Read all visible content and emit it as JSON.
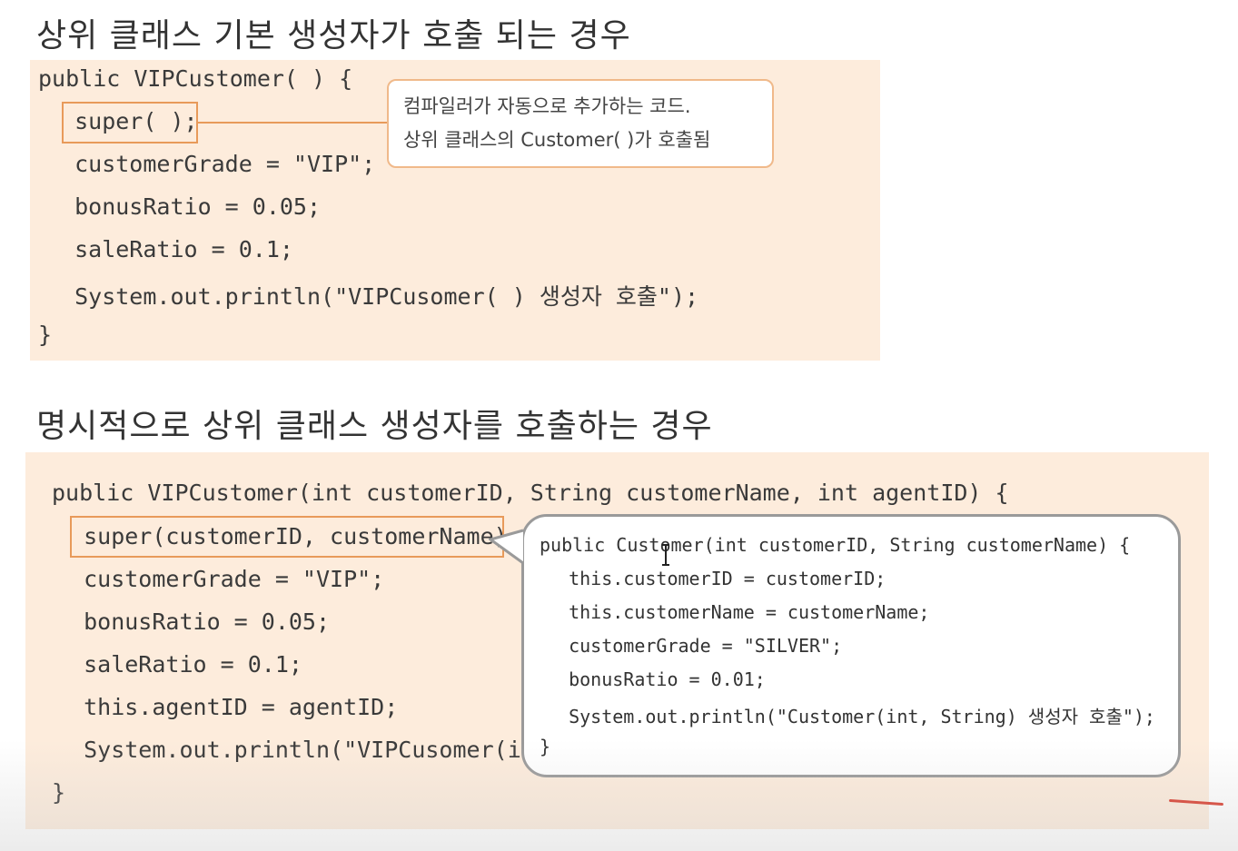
{
  "section1": {
    "heading": "상위 클래스 기본 생성자가 호출 되는 경우",
    "code": [
      "public VIPCustomer( ) {",
      "  super( );",
      "  customerGrade = \"VIP\";",
      "  bonusRatio = 0.05;",
      "  saleRatio = 0.1;",
      "  System.out.println(\"VIPCusomer( ) 생성자 호출\");",
      "}"
    ],
    "callout": {
      "line1": "컴파일러가 자동으로 추가하는 코드.",
      "line2": "상위 클래스의 Customer( )가 호출됨"
    }
  },
  "section2": {
    "heading": "명시적으로 상위 클래스 생성자를 호출하는 경우",
    "code": [
      "public VIPCustomer(int customerID, String customerName, int agentID) {",
      "  super(customerID, customerName);",
      "  customerGrade = \"VIP\";",
      "  bonusRatio = 0.05;",
      "  saleRatio = 0.1;",
      "  this.agentID = agentID;",
      "  System.out.println(\"VIPCusomer(int",
      "}"
    ],
    "bubble_code": [
      "public Customer(int customerID, String customerName) {",
      "  this.customerID = customerID;",
      "  this.customerName = customerName;",
      "  customerGrade = \"SILVER\";",
      "  bonusRatio = 0.01;",
      "  System.out.println(\"Customer(int, String) 생성자 호출\");",
      "}"
    ]
  },
  "colors": {
    "panel": "#fdecdc",
    "highlight_border": "#e89a5a",
    "bubble_border": "#9a9a9a",
    "annotation_mark": "#d93a2b"
  }
}
